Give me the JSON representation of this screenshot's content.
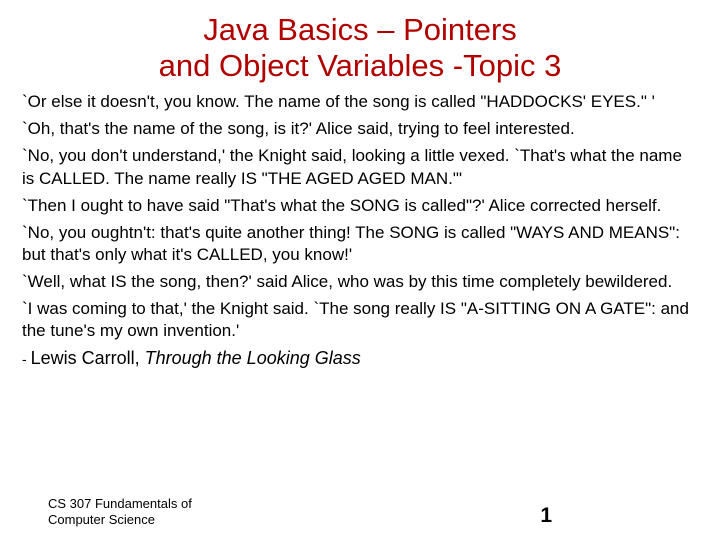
{
  "slide": {
    "title_line1": "Java Basics – Pointers",
    "title_line2": "and Object Variables -Topic 3",
    "paragraphs": [
      "`Or else it doesn't, you know. The name of the song is called \"HADDOCKS' EYES.\" '",
      "`Oh, that's the name of the song, is it?' Alice said, trying to feel interested.",
      "`No, you don't understand,' the Knight said, looking a little vexed. `That's what the name is CALLED. The name really IS \"THE AGED AGED MAN.\"'",
      "`Then I ought to have said \"That's what the SONG is called\"?' Alice corrected herself.",
      "`No, you oughtn't: that's quite another thing! The SONG is called \"WAYS AND MEANS\": but that's only what it's CALLED, you know!'",
      "`Well, what IS the song, then?' said Alice, who was by this time completely bewildered.",
      "`I was coming to that,' the Knight said. `The song really IS \"A-SITTING ON A GATE\": and the tune's my own invention.'"
    ],
    "attribution_author": "Lewis Carroll,",
    "attribution_book": "Through the Looking Glass",
    "footer_course": "CS 307 Fundamentals of Computer Science",
    "page_number": "1"
  }
}
